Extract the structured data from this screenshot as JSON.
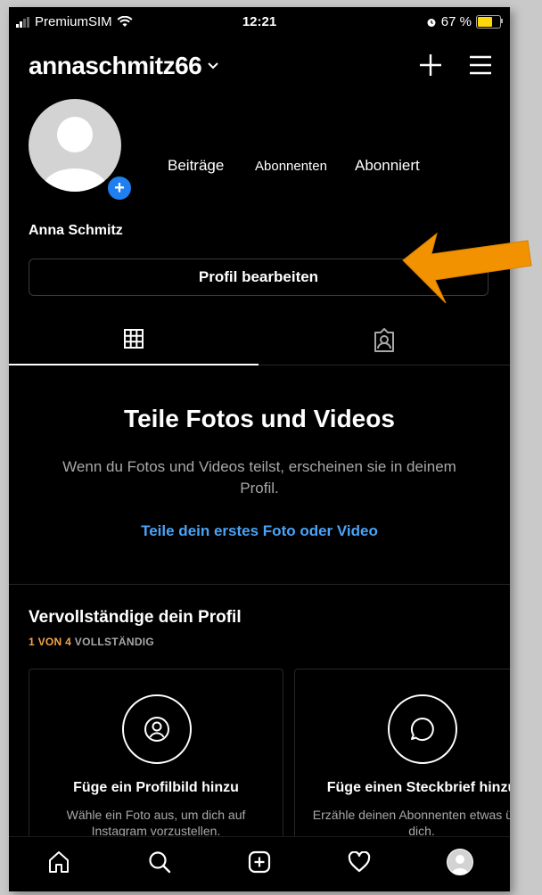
{
  "status_bar": {
    "carrier": "PremiumSIM",
    "time": "12:21",
    "battery": "67 %",
    "battery_level": 0.67
  },
  "header": {
    "username": "annaschmitz66"
  },
  "profile": {
    "stats": {
      "posts": "Beiträge",
      "followers": "Abonnenten",
      "following": "Abonniert"
    },
    "full_name": "Anna Schmitz",
    "edit_button": "Profil bearbeiten"
  },
  "tabs": [
    {
      "icon": "grid-icon",
      "active": true
    },
    {
      "icon": "tagged-icon",
      "active": false
    }
  ],
  "empty_state": {
    "title": "Teile Fotos und Videos",
    "description": "Wenn du Fotos und Videos teilst, erscheinen sie in deinem Profil.",
    "link": "Teile dein erstes Foto oder Video"
  },
  "complete_profile": {
    "title": "Vervollständige dein Profil",
    "progress_highlight": "1 VON 4",
    "progress_rest": "VOLLSTÄNDIG",
    "cards": [
      {
        "title": "Füge ein Profilbild hinzu",
        "description": "Wähle ein Foto aus, um dich auf Instagram vorzustellen."
      },
      {
        "title": "Füge einen Steckbrief hinzu",
        "description": "Erzähle deinen Abonnenten etwas über dich."
      }
    ]
  },
  "colors": {
    "background": "#000000",
    "link": "#4aa3f7",
    "accent_orange": "#f3a54a",
    "badge_blue": "#1f7fef",
    "arrow": "#f39200"
  },
  "bottom_nav": [
    "home-icon",
    "search-icon",
    "new-post-icon",
    "activity-icon",
    "profile-icon"
  ]
}
